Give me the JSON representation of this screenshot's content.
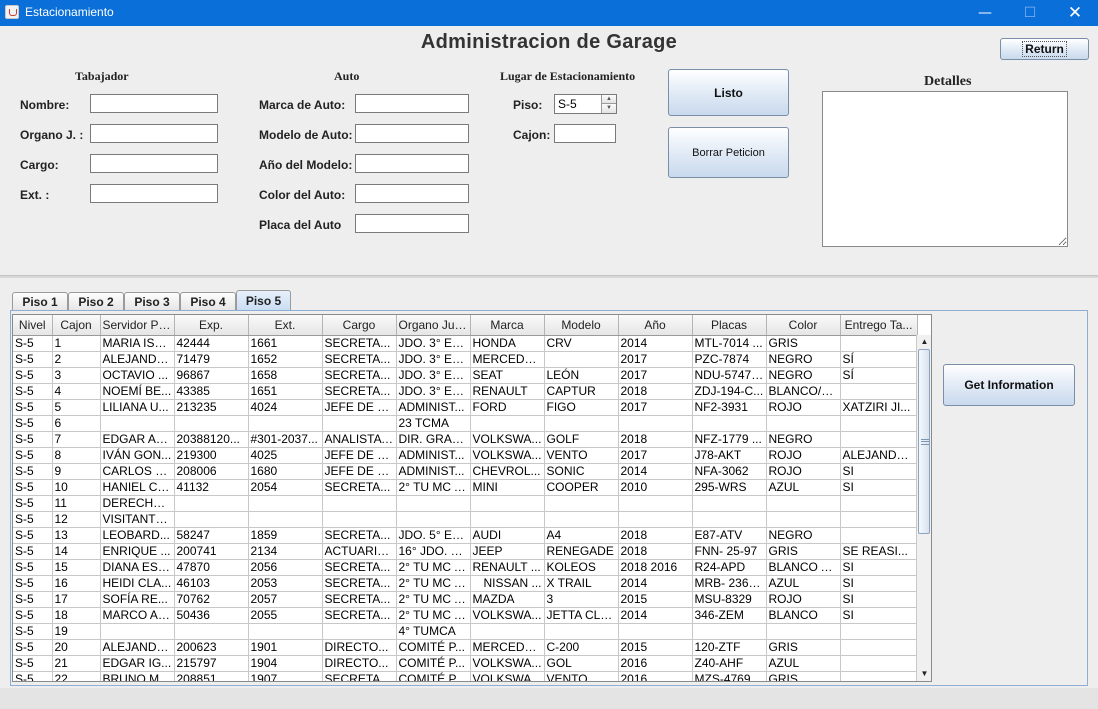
{
  "window": {
    "title": "Estacionamiento",
    "minimize": "—",
    "maximize": "☐",
    "close": "✕"
  },
  "heading": "Administracion de Garage",
  "return_label": "Return",
  "trabajador": {
    "heading": "Tabajador",
    "nombre": "Nombre:",
    "organo": "Organo J. :",
    "cargo": "Cargo:",
    "ext": "Ext. :"
  },
  "auto": {
    "heading": "Auto",
    "marca": "Marca de Auto:",
    "modelo": "Modelo de Auto:",
    "anio": "Año del Modelo:",
    "color": "Color del Auto:",
    "placa": "Placa del Auto"
  },
  "lugar": {
    "heading": "Lugar de Estacionamiento",
    "piso_label": "Piso:",
    "piso_value": "S-5",
    "cajon_label": "Cajon:"
  },
  "buttons": {
    "listo": "Listo",
    "borrar": "Borrar Peticion",
    "get_info": "Get Information"
  },
  "detalles_heading": "Detalles",
  "tabs": [
    "Piso 1",
    "Piso 2",
    "Piso 3",
    "Piso 4",
    "Piso 5"
  ],
  "active_tab": "Piso 5",
  "scroll": {
    "up": "▲",
    "down": "▼"
  },
  "table": {
    "columns": [
      "Nivel",
      "Cajon",
      "Servidor Pu...",
      "Exp.",
      "Ext.",
      "Cargo",
      "Organo Jur...",
      "Marca",
      "Modelo",
      "Año",
      "Placas",
      "Color",
      "Entrego Ta..."
    ],
    "rows": [
      [
        "S-5",
        "1",
        "MARIA ISA...",
        "42444",
        "1661",
        "SECRETA...",
        "JDO. 3° ES...",
        "HONDA",
        "CRV",
        "2014",
        "MTL-7014 ...",
        "GRIS",
        ""
      ],
      [
        "S-5",
        "2",
        "ALEJANDR...",
        "71479",
        "1652",
        "SECRETA...",
        "JDO. 3° ES...",
        "MERCEDE...",
        "",
        "2017",
        "PZC-7874",
        "NEGRO",
        "SÍ"
      ],
      [
        "S-5",
        "3",
        "OCTAVIO ...",
        "96867",
        "1658",
        "SECRETA...",
        "JDO. 3° ES...",
        "SEAT",
        "LEÓN",
        "2017",
        "NDU-5747 ...",
        "NEGRO",
        "SÍ"
      ],
      [
        "S-5",
        "4",
        "NOEMÍ BE...",
        "43385",
        "1651",
        "SECRETA...",
        "JDO. 3° ES...",
        "RENAULT",
        "CAPTUR",
        "2018",
        "ZDJ-194-C...",
        "BLANCO/N...",
        ""
      ],
      [
        "S-5",
        "5",
        "LILIANA U...",
        "213235",
        "4024",
        "JEFE DE D...",
        "ADMINIST...",
        "FORD",
        "FIGO",
        "2017",
        "NF2-3931",
        "ROJO",
        "XATZIRI JI..."
      ],
      [
        "S-5",
        "6",
        "",
        "",
        "",
        "",
        "23 TCMA",
        "",
        "",
        "",
        "",
        "",
        ""
      ],
      [
        "S-5",
        "7",
        "EDGAR AR...",
        "20388120...",
        "#301-2037...",
        "ANALISTA ...",
        "DIR. GRAL....",
        "VOLKSWA...",
        "GOLF",
        "2018",
        "NFZ-1779 ...",
        "NEGRO",
        ""
      ],
      [
        "S-5",
        "8",
        "IVÁN GON...",
        "219300",
        "4025",
        "JEFE DE D...",
        "ADMINIST...",
        "VOLKSWA...",
        "VENTO",
        "2017",
        "J78-AKT",
        "ROJO",
        "ALEJANDR..."
      ],
      [
        "S-5",
        "9",
        "CARLOS S...",
        "208006",
        "1680",
        "JEFE DE D...",
        "ADMINIST...",
        "CHEVROL...",
        "SONIC",
        "2014",
        "NFA-3062",
        "ROJO",
        "SI"
      ],
      [
        "S-5",
        "10",
        "HANIEL CA...",
        "41132",
        "2054",
        "SECRETA...",
        "2° TU MC A...",
        "MINI",
        "COOPER",
        "2010",
        "295-WRS",
        "AZUL",
        "SI"
      ],
      [
        "S-5",
        "11",
        "DERECHO...",
        "",
        "",
        "",
        "",
        "",
        "",
        "",
        "",
        "",
        ""
      ],
      [
        "S-5",
        "12",
        "VISITANTE...",
        "",
        "",
        "",
        "",
        "",
        "",
        "",
        "",
        "",
        ""
      ],
      [
        "S-5",
        "13",
        "LEOBARD...",
        "58247",
        "1859",
        "SECRETA...",
        "JDO. 5° ES...",
        "AUDI",
        "A4",
        "2018",
        "E87-ATV",
        "NEGRO",
        ""
      ],
      [
        "S-5",
        "14",
        "ENRIQUE ...",
        "200741",
        "2134",
        "ACTUARIO...",
        "16° JDO. D...",
        "JEEP",
        "RENEGADE",
        "2018",
        "FNN- 25-97",
        "GRIS",
        "SE REASI..."
      ],
      [
        "S-5",
        "15",
        "DIANA EST...",
        "47870",
        "2056",
        "SECRETA...",
        "2° TU MC A...",
        "RENAULT ...",
        "KOLEOS",
        "2018 2016",
        "R24-APD",
        "BLANCO A...",
        "SI"
      ],
      [
        "S-5",
        "16",
        "HEIDI CLA...",
        "46103",
        "2053",
        "SECRETA...",
        "2° TU MC A...",
        "NISSAN ...",
        "X TRAIL",
        "2014",
        "MRB- 2364...",
        "AZUL",
        "SI"
      ],
      [
        "S-5",
        "17",
        "SOFÍA RE...",
        "70762",
        "2057",
        "SECRETA...",
        "2° TU MC A...",
        "MAZDA",
        "3",
        "2015",
        "MSU-8329",
        "ROJO",
        "SI"
      ],
      [
        "S-5",
        "18",
        "MARCO AN...",
        "50436",
        "2055",
        "SECRETA...",
        "2° TU MC A...",
        "VOLKSWA...",
        "JETTA CLÁ...",
        "2014",
        "346-ZEM",
        "BLANCO",
        "SI"
      ],
      [
        "S-5",
        "19",
        "",
        "",
        "",
        "",
        "4° TUMCA",
        "",
        "",
        "",
        "",
        "",
        ""
      ],
      [
        "S-5",
        "20",
        "ALEJANDR...",
        "200623",
        "1901",
        "DIRECTO...",
        "COMITÉ P...",
        "MERCEDE...",
        "C-200",
        "2015",
        "120-ZTF",
        "GRIS",
        ""
      ],
      [
        "S-5",
        "21",
        "EDGAR IG...",
        "215797",
        "1904",
        "DIRECTO...",
        "COMITÉ P...",
        "VOLKSWA...",
        "GOL",
        "2016",
        "Z40-AHF",
        "AZUL",
        ""
      ],
      [
        "S-5",
        "22",
        "BRUNO M...",
        "208851",
        "1907",
        "SECRETA...",
        "COMITÉ P...",
        "VOLKSWA...",
        "VENTO",
        "2016",
        "MZS-4769",
        "GRIS",
        ""
      ]
    ]
  }
}
